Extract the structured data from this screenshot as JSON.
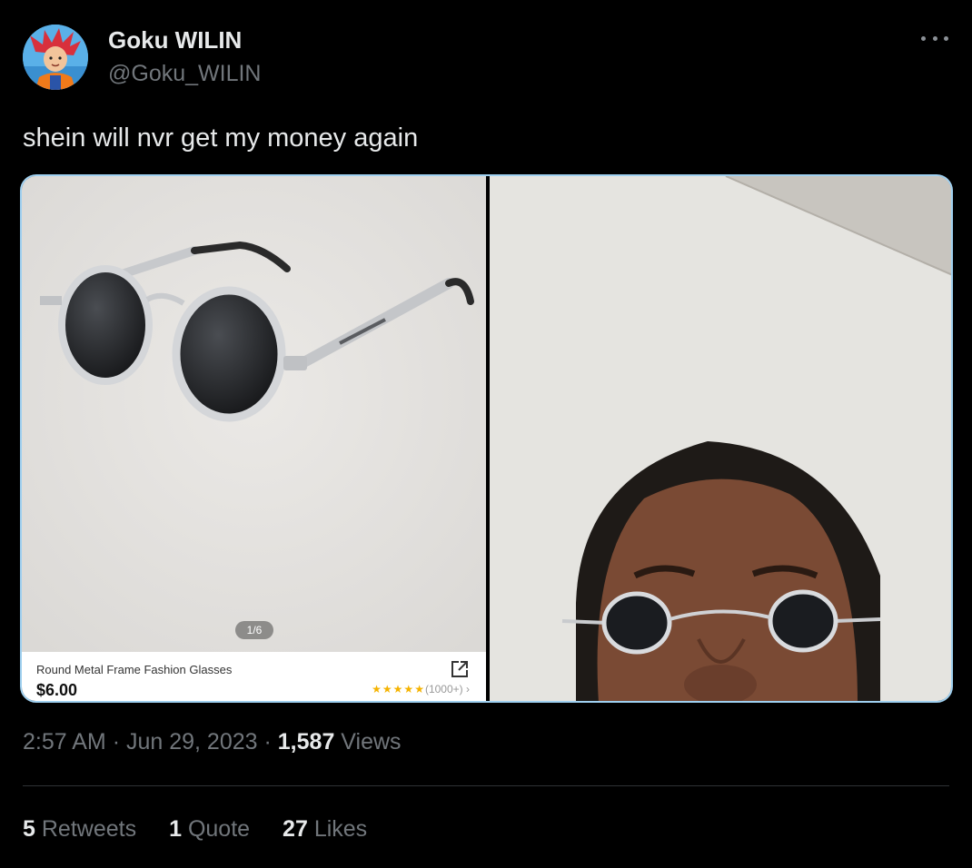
{
  "author": {
    "display_name": "Goku WILIN",
    "handle": "@Goku_WILIN",
    "avatar_icon": "goku-avatar"
  },
  "tweet": {
    "text": "shein will nvr get my money again",
    "time": "2:57 AM",
    "date": "Jun 29, 2023",
    "separator": "·",
    "views_count": "1,587",
    "views_label": "Views"
  },
  "media": {
    "left_image": {
      "pager": "1/6",
      "product_title": "Round Metal Frame Fashion Glasses",
      "price": "$6.00",
      "rating_stars": "★★★★★",
      "rating_count": "(1000+)",
      "rating_chevron": "›",
      "rating_value": 4.5
    },
    "right_image": {
      "description_icon": "selfie-photo"
    }
  },
  "engagement": {
    "retweets_count": "5",
    "retweets_label": "Retweets",
    "quotes_count": "1",
    "quotes_label": "Quote",
    "likes_count": "27",
    "likes_label": "Likes"
  },
  "colors": {
    "background": "#000000",
    "primary_text": "#e7e9ea",
    "secondary_text": "#71767b",
    "media_border": "#9fd0f0",
    "star": "#f5b300"
  }
}
